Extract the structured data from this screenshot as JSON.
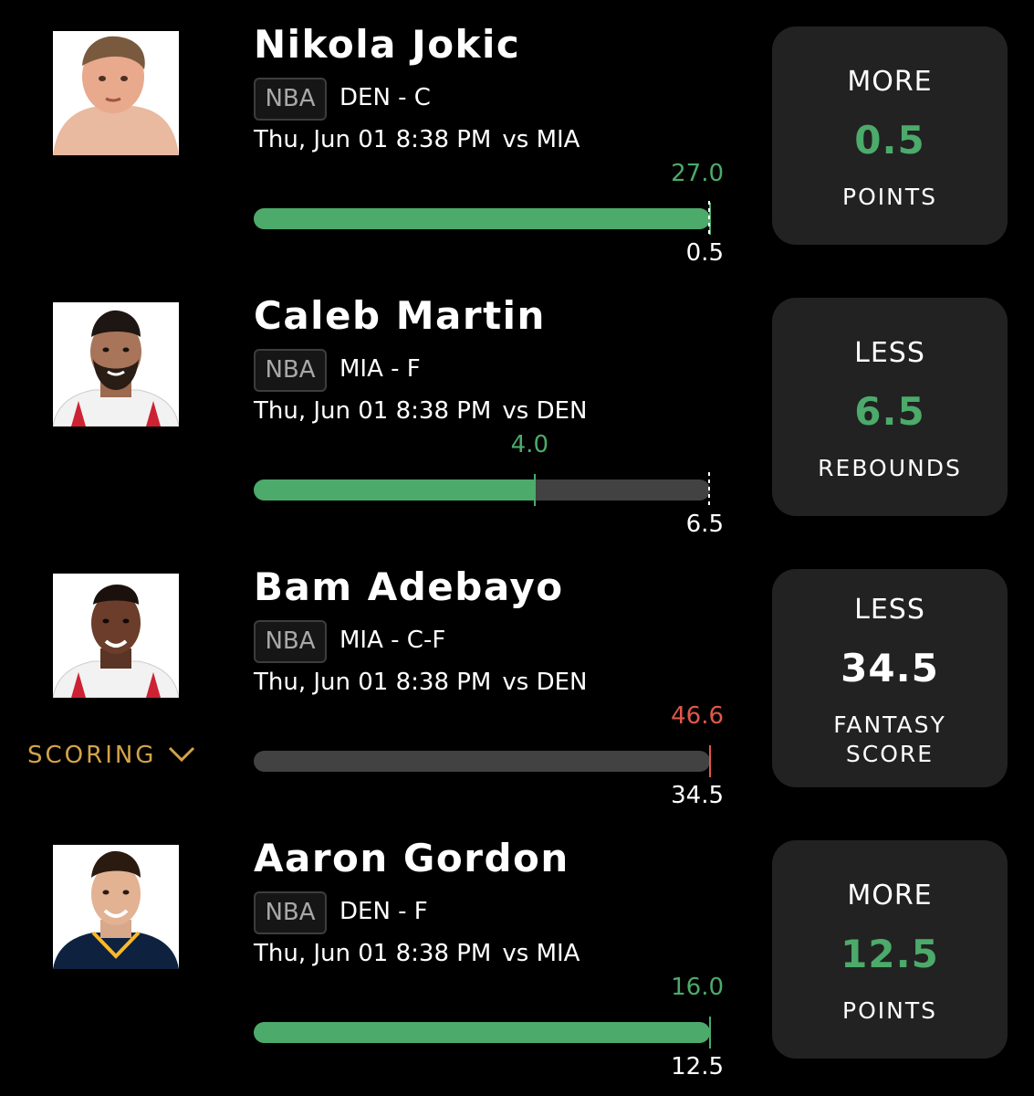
{
  "colors": {
    "background": "#000000",
    "card": "#222222",
    "green": "#4caa6a",
    "red": "#e0584a",
    "track": "#424242",
    "gold": "#d4a349"
  },
  "scoring": {
    "label": "SCORING",
    "icon": "chevron-down-icon"
  },
  "players": [
    {
      "name": "Nikola Jokic",
      "league": "NBA",
      "team_pos": "DEN - C",
      "datetime": "Thu, Jun 01 8:38 PM",
      "opponent": "vs MIA",
      "actual": "27.0",
      "line": "0.5",
      "progress": 1.0,
      "status": "hit",
      "pick": "MORE",
      "pick_value": "0.5",
      "stat": "POINTS",
      "photo": "jersey-photo-icon"
    },
    {
      "name": "Caleb Martin",
      "league": "NBA",
      "team_pos": "MIA - F",
      "datetime": "Thu, Jun 01 8:38 PM",
      "opponent": "vs DEN",
      "actual": "4.0",
      "line": "6.5",
      "progress": 0.615,
      "status": "hit",
      "pick": "LESS",
      "pick_value": "6.5",
      "stat": "REBOUNDS",
      "photo": "jersey-photo-icon"
    },
    {
      "name": "Bam Adebayo",
      "league": "NBA",
      "team_pos": "MIA - C-F",
      "datetime": "Thu, Jun 01 8:38 PM",
      "opponent": "vs DEN",
      "actual": "46.6",
      "line": "34.5",
      "progress": 1.0,
      "status": "miss",
      "pick": "LESS",
      "pick_value": "34.5",
      "stat": "FANTASY\nSCORE",
      "photo": "jersey-photo-icon"
    },
    {
      "name": "Aaron Gordon",
      "league": "NBA",
      "team_pos": "DEN - F",
      "datetime": "Thu, Jun 01 8:38 PM",
      "opponent": "vs MIA",
      "actual": "16.0",
      "line": "12.5",
      "progress": 1.0,
      "status": "hit",
      "pick": "MORE",
      "pick_value": "12.5",
      "stat": "POINTS",
      "photo": "jersey-photo-icon"
    }
  ]
}
